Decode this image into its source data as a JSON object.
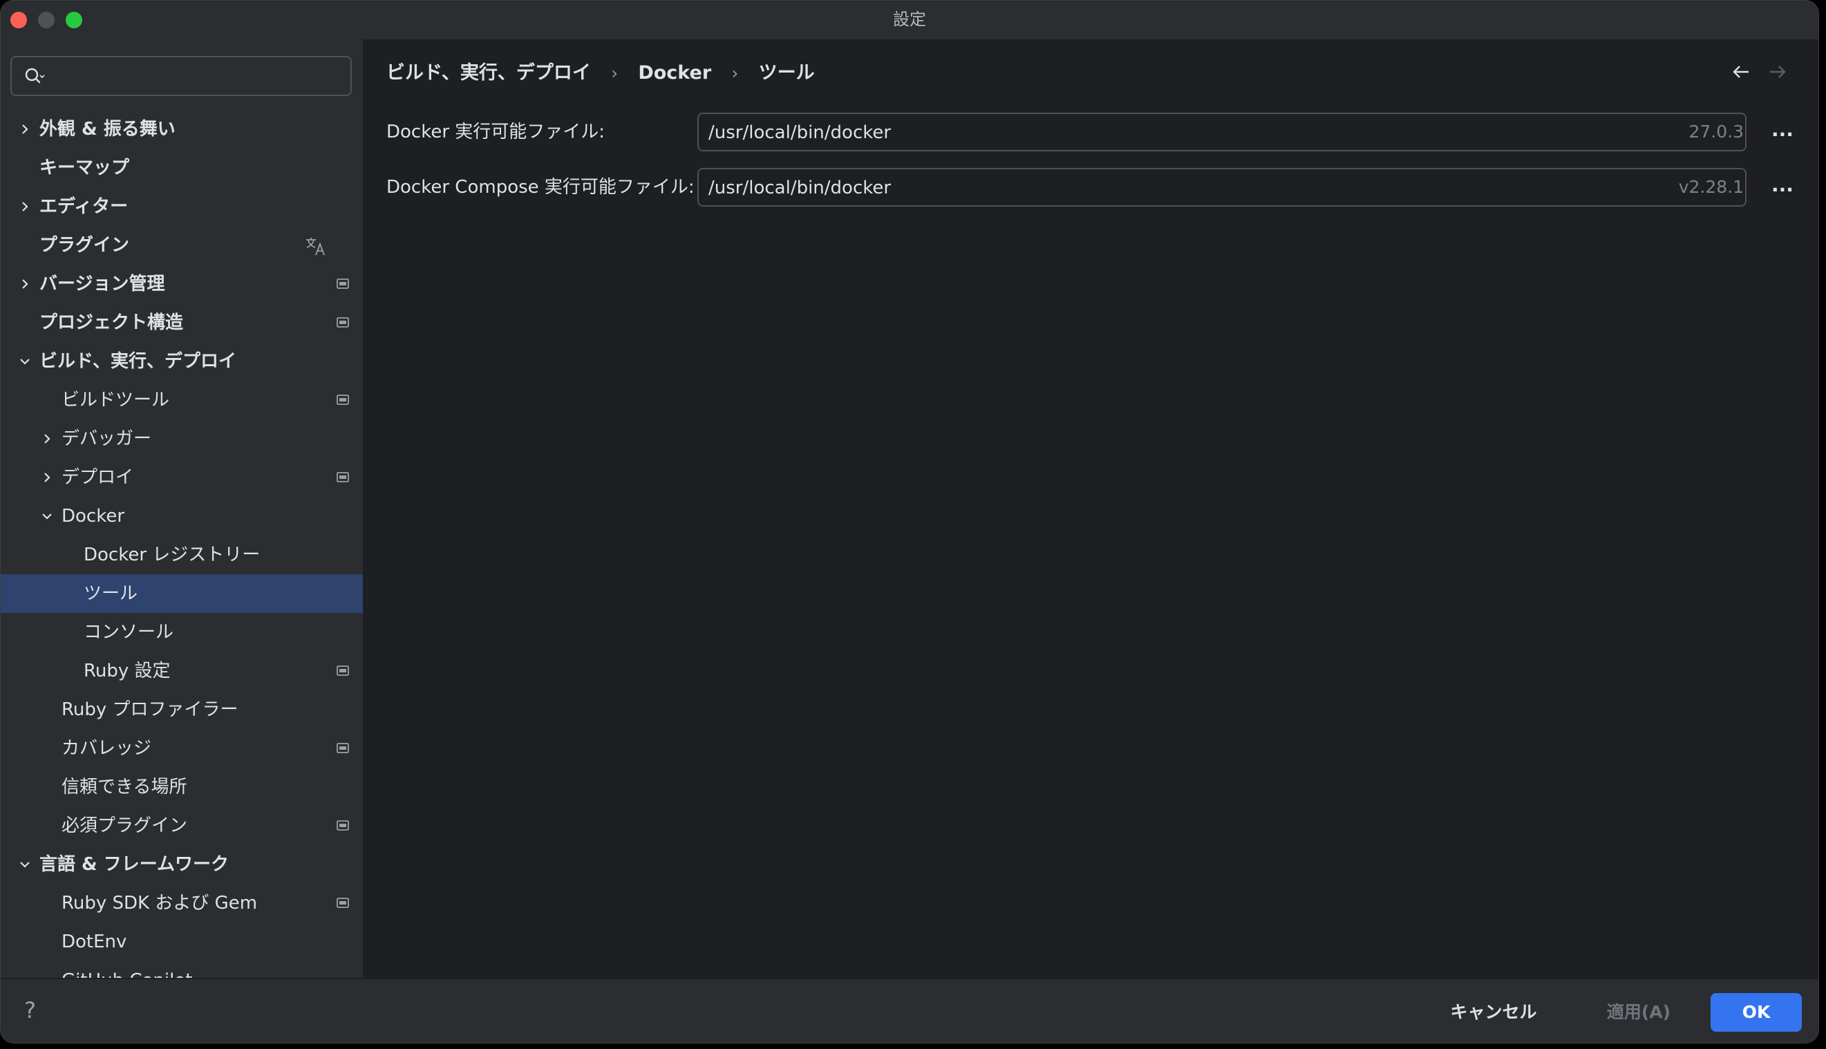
{
  "window": {
    "title": "設定"
  },
  "search": {
    "placeholder": "",
    "value": ""
  },
  "sidebar": {
    "items": [
      {
        "label": "外観 & 振る舞い",
        "expanded": false,
        "badge": ""
      },
      {
        "label": "キーマップ",
        "badge": ""
      },
      {
        "label": "エディター",
        "expanded": false,
        "badge": ""
      },
      {
        "label": "プラグイン",
        "badge": "translate-icon"
      },
      {
        "label": "バージョン管理",
        "expanded": false,
        "badge": "project-icon"
      },
      {
        "label": "プロジェクト構造",
        "badge": "project-icon"
      },
      {
        "label": "ビルド、実行、デプロイ",
        "expanded": true,
        "badge": ""
      },
      {
        "label": "ビルドツール",
        "badge": "project-icon"
      },
      {
        "label": "デバッガー",
        "expanded": false,
        "badge": ""
      },
      {
        "label": "デプロイ",
        "expanded": false,
        "badge": "project-icon"
      },
      {
        "label": "Docker",
        "expanded": true,
        "badge": ""
      },
      {
        "label": "Docker レジストリー",
        "badge": ""
      },
      {
        "label": "ツール",
        "badge": "",
        "selected": true
      },
      {
        "label": "コンソール",
        "badge": ""
      },
      {
        "label": "Ruby 設定",
        "badge": "project-icon"
      },
      {
        "label": "Ruby プロファイラー",
        "badge": ""
      },
      {
        "label": "カバレッジ",
        "badge": "project-icon"
      },
      {
        "label": "信頼できる場所",
        "badge": ""
      },
      {
        "label": "必須プラグイン",
        "badge": "project-icon"
      },
      {
        "label": "言語 & フレームワーク",
        "expanded": true,
        "badge": ""
      },
      {
        "label": "Ruby SDK および Gem",
        "badge": "project-icon"
      },
      {
        "label": "DotEnv",
        "badge": ""
      },
      {
        "label": "GitHub Copilot",
        "badge": ""
      }
    ]
  },
  "breadcrumb": [
    "ビルド、実行、デプロイ",
    "Docker",
    "ツール"
  ],
  "fields": [
    {
      "label": "Docker 実行可能ファイル:",
      "value": "/usr/local/bin/docker",
      "version": "27.0.3",
      "browse": "..."
    },
    {
      "label": "Docker Compose 実行可能ファイル:",
      "value": "/usr/local/bin/docker",
      "version": "v2.28.1",
      "browse": "..."
    }
  ],
  "footer": {
    "help": "?",
    "cancel": "キャンセル",
    "apply": "適用(A)",
    "ok": "OK"
  },
  "colors": {
    "accent": "#3574f0",
    "selection": "#2e436e",
    "panel": "#2b2d30",
    "content": "#1e1f22"
  }
}
